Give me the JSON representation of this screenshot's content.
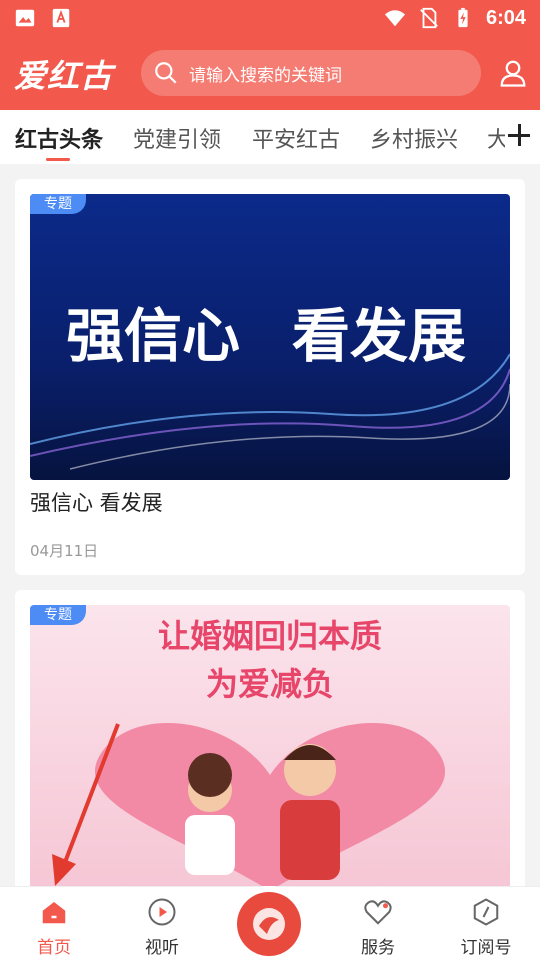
{
  "status_bar": {
    "time": "6:04"
  },
  "header": {
    "logo": "爱红古",
    "search_placeholder": "请输入搜索的关键词"
  },
  "tabs": [
    "红古头条",
    "党建引领",
    "平安红古",
    "乡村振兴",
    "大"
  ],
  "cards": [
    {
      "badge": "专题",
      "image_text": [
        "强信心",
        "看发展"
      ],
      "title": "强信心  看发展",
      "date": "04月11日"
    },
    {
      "badge": "专题",
      "image_text": [
        "让婚姻回归本质",
        "为爱减负"
      ]
    }
  ],
  "bottom_nav": [
    {
      "label": "首页",
      "icon": "home-icon"
    },
    {
      "label": "视听",
      "icon": "play-icon"
    },
    {
      "label": "",
      "icon": "center-logo-icon"
    },
    {
      "label": "服务",
      "icon": "heart-icon"
    },
    {
      "label": "订阅号",
      "icon": "compass-icon"
    }
  ],
  "colors": {
    "brand": "#f2584c",
    "badge": "#4d8bf5"
  }
}
